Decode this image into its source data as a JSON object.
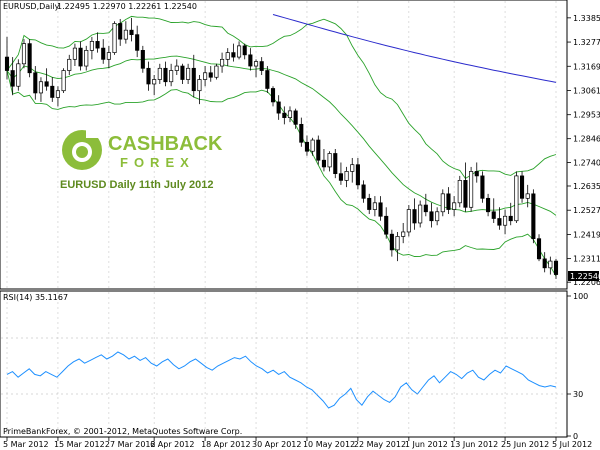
{
  "chart_data": [
    {
      "type": "candlestick",
      "symbol_label": "EURUSD,Daily",
      "ohlc_header": "1.22495 1.22970 1.22261 1.22540",
      "price_labels": [
        "1.33850",
        "1.32770",
        "1.31690",
        "1.30610",
        "1.29530",
        "1.28460",
        "1.27400",
        "1.26350",
        "1.25270",
        "1.24190",
        "1.23110",
        "1.22060"
      ],
      "current_price_label": "1.22540",
      "ylim": [
        1.218,
        1.342
      ],
      "overlays": [
        "Bollinger Bands (upper, middle, lower)",
        "Moving average (blue)"
      ],
      "colors": {
        "up_body": "#ffffff",
        "down_body": "#000000",
        "bands": "#2aa22a",
        "ma": "#2b2bcc"
      },
      "candles": [
        {
          "o": 1.321,
          "h": 1.33,
          "l": 1.311,
          "c": 1.315
        },
        {
          "o": 1.315,
          "h": 1.321,
          "l": 1.304,
          "c": 1.308
        },
        {
          "o": 1.308,
          "h": 1.32,
          "l": 1.306,
          "c": 1.318
        },
        {
          "o": 1.318,
          "h": 1.329,
          "l": 1.316,
          "c": 1.327
        },
        {
          "o": 1.327,
          "h": 1.329,
          "l": 1.312,
          "c": 1.314
        },
        {
          "o": 1.314,
          "h": 1.317,
          "l": 1.302,
          "c": 1.305
        },
        {
          "o": 1.305,
          "h": 1.312,
          "l": 1.301,
          "c": 1.31
        },
        {
          "o": 1.31,
          "h": 1.316,
          "l": 1.306,
          "c": 1.308
        },
        {
          "o": 1.308,
          "h": 1.312,
          "l": 1.301,
          "c": 1.303
        },
        {
          "o": 1.303,
          "h": 1.308,
          "l": 1.299,
          "c": 1.306
        },
        {
          "o": 1.306,
          "h": 1.316,
          "l": 1.305,
          "c": 1.315
        },
        {
          "o": 1.315,
          "h": 1.322,
          "l": 1.313,
          "c": 1.32
        },
        {
          "o": 1.32,
          "h": 1.327,
          "l": 1.317,
          "c": 1.325
        },
        {
          "o": 1.325,
          "h": 1.328,
          "l": 1.315,
          "c": 1.317
        },
        {
          "o": 1.317,
          "h": 1.326,
          "l": 1.315,
          "c": 1.324
        },
        {
          "o": 1.324,
          "h": 1.33,
          "l": 1.32,
          "c": 1.328
        },
        {
          "o": 1.328,
          "h": 1.332,
          "l": 1.323,
          "c": 1.325
        },
        {
          "o": 1.325,
          "h": 1.329,
          "l": 1.318,
          "c": 1.32
        },
        {
          "o": 1.32,
          "h": 1.326,
          "l": 1.316,
          "c": 1.323
        },
        {
          "o": 1.323,
          "h": 1.337,
          "l": 1.322,
          "c": 1.336
        },
        {
          "o": 1.336,
          "h": 1.338,
          "l": 1.326,
          "c": 1.329
        },
        {
          "o": 1.329,
          "h": 1.337,
          "l": 1.327,
          "c": 1.333
        },
        {
          "o": 1.333,
          "h": 1.3385,
          "l": 1.328,
          "c": 1.331
        },
        {
          "o": 1.331,
          "h": 1.335,
          "l": 1.321,
          "c": 1.324
        },
        {
          "o": 1.324,
          "h": 1.326,
          "l": 1.314,
          "c": 1.316
        },
        {
          "o": 1.316,
          "h": 1.319,
          "l": 1.306,
          "c": 1.309
        },
        {
          "o": 1.309,
          "h": 1.313,
          "l": 1.304,
          "c": 1.311
        },
        {
          "o": 1.311,
          "h": 1.318,
          "l": 1.309,
          "c": 1.316
        },
        {
          "o": 1.316,
          "h": 1.319,
          "l": 1.308,
          "c": 1.31
        },
        {
          "o": 1.31,
          "h": 1.318,
          "l": 1.308,
          "c": 1.315
        },
        {
          "o": 1.315,
          "h": 1.32,
          "l": 1.313,
          "c": 1.317
        },
        {
          "o": 1.317,
          "h": 1.318,
          "l": 1.309,
          "c": 1.311
        },
        {
          "o": 1.311,
          "h": 1.318,
          "l": 1.309,
          "c": 1.316
        },
        {
          "o": 1.316,
          "h": 1.322,
          "l": 1.303,
          "c": 1.306
        },
        {
          "o": 1.306,
          "h": 1.313,
          "l": 1.3,
          "c": 1.311
        },
        {
          "o": 1.311,
          "h": 1.317,
          "l": 1.308,
          "c": 1.314
        },
        {
          "o": 1.314,
          "h": 1.317,
          "l": 1.31,
          "c": 1.312
        },
        {
          "o": 1.312,
          "h": 1.318,
          "l": 1.311,
          "c": 1.317
        },
        {
          "o": 1.317,
          "h": 1.323,
          "l": 1.314,
          "c": 1.32
        },
        {
          "o": 1.32,
          "h": 1.325,
          "l": 1.317,
          "c": 1.323
        },
        {
          "o": 1.323,
          "h": 1.327,
          "l": 1.319,
          "c": 1.321
        },
        {
          "o": 1.321,
          "h": 1.328,
          "l": 1.32,
          "c": 1.326
        },
        {
          "o": 1.326,
          "h": 1.327,
          "l": 1.32,
          "c": 1.322
        },
        {
          "o": 1.322,
          "h": 1.325,
          "l": 1.315,
          "c": 1.317
        },
        {
          "o": 1.317,
          "h": 1.32,
          "l": 1.312,
          "c": 1.319
        },
        {
          "o": 1.319,
          "h": 1.321,
          "l": 1.313,
          "c": 1.315
        },
        {
          "o": 1.315,
          "h": 1.317,
          "l": 1.305,
          "c": 1.307
        },
        {
          "o": 1.307,
          "h": 1.308,
          "l": 1.299,
          "c": 1.301
        },
        {
          "o": 1.301,
          "h": 1.304,
          "l": 1.293,
          "c": 1.296
        },
        {
          "o": 1.296,
          "h": 1.299,
          "l": 1.291,
          "c": 1.294
        },
        {
          "o": 1.294,
          "h": 1.299,
          "l": 1.292,
          "c": 1.297
        },
        {
          "o": 1.297,
          "h": 1.298,
          "l": 1.289,
          "c": 1.291
        },
        {
          "o": 1.291,
          "h": 1.294,
          "l": 1.281,
          "c": 1.283
        },
        {
          "o": 1.283,
          "h": 1.286,
          "l": 1.277,
          "c": 1.279
        },
        {
          "o": 1.279,
          "h": 1.285,
          "l": 1.277,
          "c": 1.284
        },
        {
          "o": 1.284,
          "h": 1.286,
          "l": 1.273,
          "c": 1.275
        },
        {
          "o": 1.275,
          "h": 1.28,
          "l": 1.27,
          "c": 1.272
        },
        {
          "o": 1.272,
          "h": 1.279,
          "l": 1.27,
          "c": 1.278
        },
        {
          "o": 1.278,
          "h": 1.28,
          "l": 1.267,
          "c": 1.269
        },
        {
          "o": 1.269,
          "h": 1.274,
          "l": 1.264,
          "c": 1.266
        },
        {
          "o": 1.266,
          "h": 1.272,
          "l": 1.263,
          "c": 1.27
        },
        {
          "o": 1.27,
          "h": 1.276,
          "l": 1.265,
          "c": 1.273
        },
        {
          "o": 1.273,
          "h": 1.276,
          "l": 1.262,
          "c": 1.264
        },
        {
          "o": 1.264,
          "h": 1.266,
          "l": 1.256,
          "c": 1.258
        },
        {
          "o": 1.258,
          "h": 1.26,
          "l": 1.251,
          "c": 1.253
        },
        {
          "o": 1.253,
          "h": 1.259,
          "l": 1.25,
          "c": 1.256
        },
        {
          "o": 1.256,
          "h": 1.259,
          "l": 1.248,
          "c": 1.25
        },
        {
          "o": 1.25,
          "h": 1.254,
          "l": 1.24,
          "c": 1.242
        },
        {
          "o": 1.242,
          "h": 1.244,
          "l": 1.232,
          "c": 1.235
        },
        {
          "o": 1.235,
          "h": 1.243,
          "l": 1.23,
          "c": 1.241
        },
        {
          "o": 1.241,
          "h": 1.247,
          "l": 1.238,
          "c": 1.243
        },
        {
          "o": 1.243,
          "h": 1.255,
          "l": 1.241,
          "c": 1.253
        },
        {
          "o": 1.253,
          "h": 1.258,
          "l": 1.244,
          "c": 1.247
        },
        {
          "o": 1.247,
          "h": 1.257,
          "l": 1.245,
          "c": 1.255
        },
        {
          "o": 1.255,
          "h": 1.26,
          "l": 1.25,
          "c": 1.252
        },
        {
          "o": 1.252,
          "h": 1.256,
          "l": 1.245,
          "c": 1.248
        },
        {
          "o": 1.248,
          "h": 1.254,
          "l": 1.246,
          "c": 1.252
        },
        {
          "o": 1.252,
          "h": 1.262,
          "l": 1.25,
          "c": 1.26
        },
        {
          "o": 1.26,
          "h": 1.263,
          "l": 1.251,
          "c": 1.253
        },
        {
          "o": 1.253,
          "h": 1.259,
          "l": 1.25,
          "c": 1.256
        },
        {
          "o": 1.256,
          "h": 1.268,
          "l": 1.254,
          "c": 1.266
        },
        {
          "o": 1.266,
          "h": 1.274,
          "l": 1.252,
          "c": 1.254
        },
        {
          "o": 1.254,
          "h": 1.272,
          "l": 1.252,
          "c": 1.27
        },
        {
          "o": 1.27,
          "h": 1.274,
          "l": 1.265,
          "c": 1.268
        },
        {
          "o": 1.268,
          "h": 1.27,
          "l": 1.256,
          "c": 1.258
        },
        {
          "o": 1.258,
          "h": 1.26,
          "l": 1.25,
          "c": 1.252
        },
        {
          "o": 1.252,
          "h": 1.258,
          "l": 1.247,
          "c": 1.249
        },
        {
          "o": 1.249,
          "h": 1.254,
          "l": 1.244,
          "c": 1.246
        },
        {
          "o": 1.246,
          "h": 1.253,
          "l": 1.242,
          "c": 1.25
        },
        {
          "o": 1.25,
          "h": 1.256,
          "l": 1.246,
          "c": 1.248
        },
        {
          "o": 1.248,
          "h": 1.27,
          "l": 1.247,
          "c": 1.268
        },
        {
          "o": 1.268,
          "h": 1.27,
          "l": 1.256,
          "c": 1.258
        },
        {
          "o": 1.258,
          "h": 1.264,
          "l": 1.254,
          "c": 1.26
        },
        {
          "o": 1.26,
          "h": 1.262,
          "l": 1.238,
          "c": 1.24
        },
        {
          "o": 1.24,
          "h": 1.242,
          "l": 1.23,
          "c": 1.231
        },
        {
          "o": 1.231,
          "h": 1.234,
          "l": 1.225,
          "c": 1.227
        },
        {
          "o": 1.227,
          "h": 1.232,
          "l": 1.224,
          "c": 1.23
        },
        {
          "o": 1.23,
          "h": 1.231,
          "l": 1.222,
          "c": 1.224
        }
      ]
    },
    {
      "type": "line",
      "label": "RSI(14) 35.1167",
      "ylim": [
        0,
        100
      ],
      "levels": [
        30,
        70
      ],
      "tick_labels": [
        "100",
        "30",
        "0"
      ],
      "values": [
        44,
        46,
        42,
        45,
        48,
        44,
        43,
        46,
        44,
        42,
        46,
        50,
        53,
        55,
        52,
        54,
        56,
        58,
        55,
        57,
        60,
        58,
        55,
        57,
        54,
        56,
        52,
        50,
        53,
        55,
        51,
        48,
        50,
        53,
        55,
        52,
        49,
        47,
        50,
        52,
        54,
        56,
        55,
        57,
        53,
        50,
        48,
        45,
        47,
        44,
        46,
        42,
        40,
        38,
        35,
        33,
        29,
        25,
        20,
        22,
        27,
        30,
        34,
        26,
        22,
        28,
        32,
        29,
        26,
        24,
        28,
        35,
        38,
        33,
        30,
        35,
        40,
        43,
        38,
        42,
        46,
        44,
        41,
        45,
        47,
        42,
        40,
        44,
        47,
        45,
        50,
        48,
        46,
        44,
        40,
        38,
        36,
        35,
        36,
        35
      ]
    }
  ],
  "x_axis_labels": [
    "5 Mar 2012",
    "15 Mar 2012",
    "27 Mar 2012",
    "6 Apr 2012",
    "18 Apr 2012",
    "30 Apr 2012",
    "10 May 2012",
    "22 May 2012",
    "1 Jun 2012",
    "13 Jun 2012",
    "25 Jun 2012",
    "5 Jul 2012"
  ],
  "watermark": {
    "brand_top": "CASHBACK",
    "brand_bottom": "FOREX",
    "caption": "EURUSD  Daily  11th July 2012"
  },
  "footer_text": "PrimeBankForex, © 2001-2012, MetaQuotes Software Corp."
}
